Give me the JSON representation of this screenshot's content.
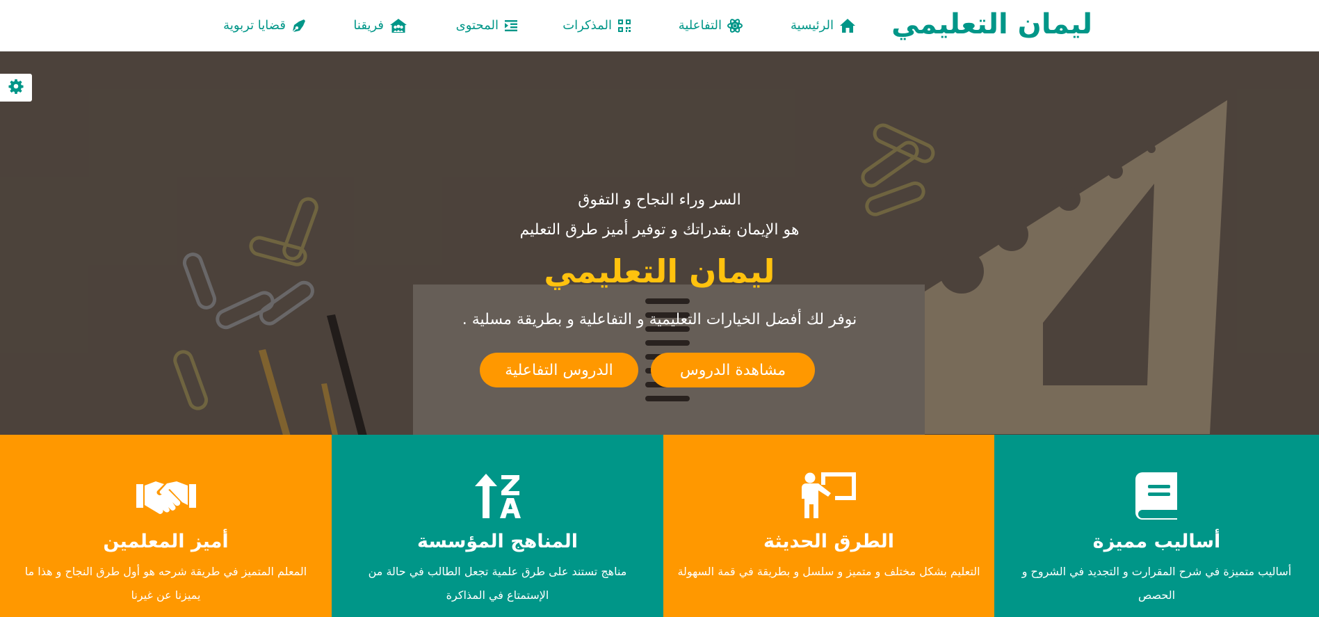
{
  "header": {
    "logo": "ليمان التعليمي",
    "nav": [
      {
        "label": "الرئيسية",
        "icon": "home-icon"
      },
      {
        "label": "التفاعلية",
        "icon": "atom-icon"
      },
      {
        "label": "المذكرات",
        "icon": "qrcode-icon"
      },
      {
        "label": "المحتوى",
        "icon": "indent-icon"
      },
      {
        "label": "فريقنا",
        "icon": "team-icon"
      },
      {
        "label": "قضايا تربوية",
        "icon": "pen-nib-icon"
      }
    ]
  },
  "hero": {
    "line1": "السر وراء النجاح و التفوق",
    "line2": "هو الإيمان بقدراتك و توفير أميز طرق التعليم",
    "title": "ليمان التعليمي",
    "line3": "نوفر لك أفضل الخيارات التعليمية و التفاعلية و بطريقة مسلية .",
    "btn_watch": "مشاهدة الدروس",
    "btn_interactive": "الدروس التفاعلية",
    "settings_icon": "gear-icon"
  },
  "features": [
    {
      "title": "أساليب مميزة",
      "desc": "أساليب متميزة في شرح المقرارت و التجديد في الشروح و الحصص",
      "icon": "book-icon",
      "color": "#009688"
    },
    {
      "title": "الطرق الحديثة",
      "desc": "التعليم بشكل مختلف و متميز و سلسل و بطريقة في قمة السهولة",
      "icon": "teacher-board-icon",
      "color": "#ff9800"
    },
    {
      "title": "المناهج المؤسسة",
      "desc": "مناهج تستند على طرق علمية تجعل الطالب في حالة من الإستمتاع في المذاكرة",
      "icon": "sort-alpha-up-icon",
      "color": "#009688"
    },
    {
      "title": "أميز المعلمين",
      "desc": "المعلم المتميز في طريقة شرحه هو أول طرق النجاح و هذا ما يميزنا عن غيرنا",
      "icon": "handshake-icon",
      "color": "#ff9800"
    }
  ],
  "colors": {
    "teal": "#009688",
    "orange": "#ff9800",
    "hero_title": "#ffc20e"
  }
}
